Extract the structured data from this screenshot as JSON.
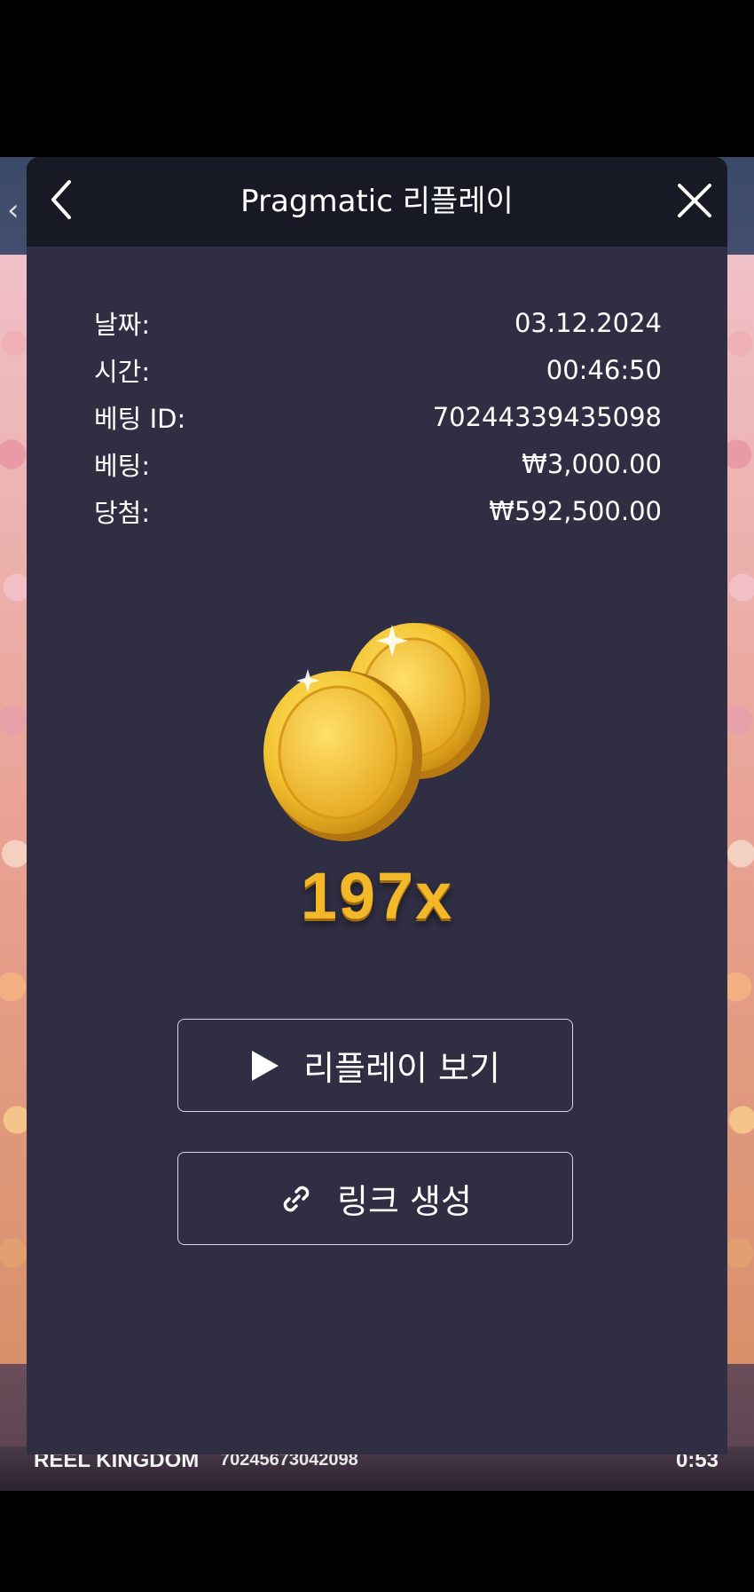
{
  "background": {
    "provider": "REEL KINGDOM",
    "round_id": "70245673042098",
    "time": "0:53"
  },
  "modal": {
    "title": "Pragmatic 리플레이",
    "details": [
      {
        "label": "날짜:",
        "value": "03.12.2024"
      },
      {
        "label": "시간:",
        "value": "00:46:50"
      },
      {
        "label": "베팅 ID:",
        "value": "70244339435098"
      },
      {
        "label": "베팅:",
        "value": "₩3,000.00"
      },
      {
        "label": "당첨:",
        "value": "₩592,500.00"
      }
    ],
    "multiplier": "197x",
    "buttons": {
      "replay": "리플레이 보기",
      "link": "링크 생성"
    }
  },
  "icons": [
    "chevron-left-icon",
    "close-icon",
    "coins-icon",
    "play-icon",
    "link-icon"
  ],
  "colors": {
    "modal_bg": "#2f2e42",
    "header_bg": "#171925",
    "multiplier": "#f2b82a",
    "coin_gold": "#f2c230"
  }
}
